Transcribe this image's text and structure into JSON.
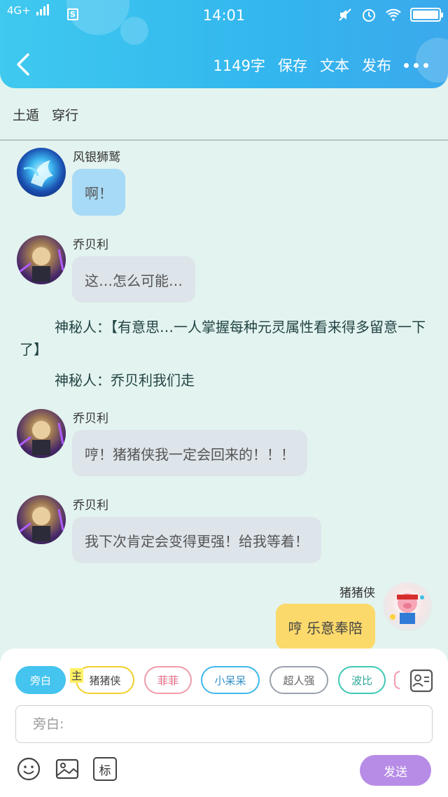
{
  "status_bar": {
    "network": "4G+",
    "time": "14:01",
    "sim_icon_text": "S",
    "battery_percent": 100
  },
  "toolbar": {
    "word_count": "1149字",
    "save": "保存",
    "text": "文本",
    "publish": "发布"
  },
  "tags": [
    "土遁",
    "穿行"
  ],
  "messages": [
    {
      "name": "风银狮鹫",
      "text": "啊！"
    },
    {
      "name": "乔贝利",
      "text": "这…怎么可能…"
    },
    {
      "name": "乔贝利",
      "text": "哼！猪猪侠我一定会回来的！！！"
    },
    {
      "name": "乔贝利",
      "text": "我下次肯定会变得更强！给我等着！"
    },
    {
      "name": "猪猪侠",
      "text": "哼 乐意奉陪"
    }
  ],
  "narration": [
    "神秘人：【有意思…一人掌握每种元灵属性看来得多留意一下了】",
    "神秘人：乔贝利我们走"
  ],
  "composer": {
    "roles": [
      "旁白",
      "猪猪侠",
      "菲菲",
      "小呆呆",
      "超人强",
      "波比"
    ],
    "main_badge": "主",
    "input_placeholder": "旁白:",
    "send_label": "发送",
    "mark_button": "标"
  },
  "colors": {
    "header": "#33b6ee",
    "background": "#e3f3ef",
    "blue_bubble": "#a7daf6",
    "grey_bubble": "#dde4ea",
    "yellow_bubble": "#fbd96b",
    "send": "#b78ce6"
  }
}
